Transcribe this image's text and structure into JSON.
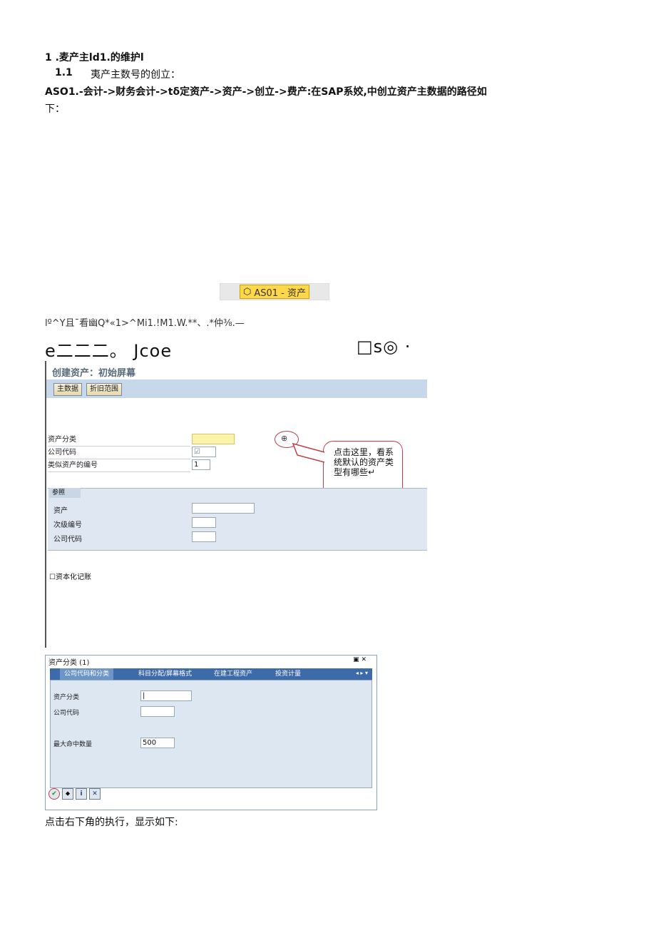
{
  "heading1": "1    .麦产主ld1.的维护l",
  "heading2_num": "1.1",
  "heading2_text": "夷产主数号的创立：",
  "path_line1": "ASO1.-会计->财务会计->tδ定资产->资产->创立->费产:在SAP系姣,中创立资产主数据的路径如",
  "path_line2": "下：",
  "tcode_chip": "AS01 - 资产",
  "garbled_menu": "lº^Y且¯看幽Q*«1>^Mi1.!M1.W.**、.*仲⅜.—",
  "toolbar_left": "e二二二。 Jcoe",
  "toolbar_right": "□s◎ ·",
  "screen1": {
    "title": "创建资产：初始屏幕",
    "btn_master": "主数据",
    "btn_depr": "折旧范围",
    "lbl_asset_class": "资产分类",
    "lbl_company_code": "公司代码",
    "lbl_similar": "类似资产的编号",
    "similar_value": "1",
    "ref_title": "参照",
    "lbl_asset": "资产",
    "lbl_subnumber": "次级编号",
    "lbl_ref_company": "公司代码",
    "chk_capitalization": "资本化记账",
    "callout": "点击这里，看系统默认的资产类型有哪些↵"
  },
  "screen2": {
    "title": "资产分类 (1)",
    "tabs": [
      "公司代码和分类",
      "科目分配/屏幕格式",
      "在建工程资产",
      "投资计量"
    ],
    "lbl_class": "资产分类",
    "lbl_company": "公司代码",
    "lbl_max_hits": "最大命中数量",
    "max_hits_value": "500"
  },
  "footer_text": "点击右下角的执行，显示如下:"
}
